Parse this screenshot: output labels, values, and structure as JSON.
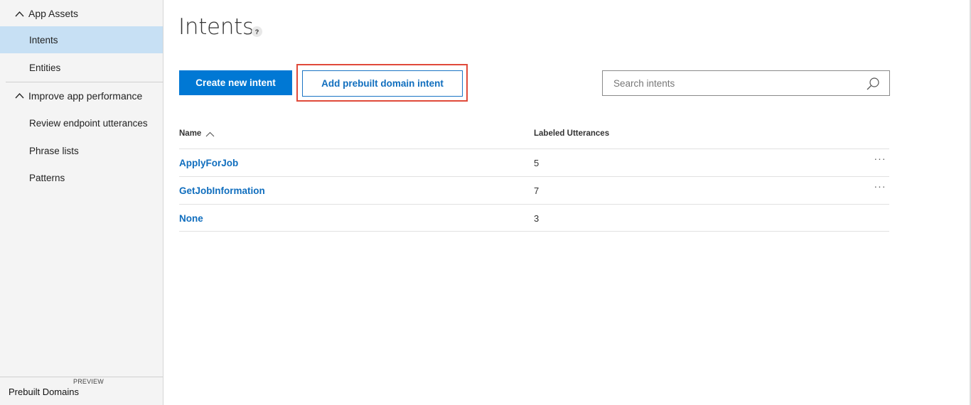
{
  "sidebar": {
    "sections": [
      {
        "label": "App Assets",
        "icon": "chevron-up-icon"
      },
      {
        "label": "Improve app performance",
        "icon": "chevron-up-icon"
      }
    ],
    "items": [
      {
        "label": "Intents",
        "active": true
      },
      {
        "label": "Entities"
      },
      {
        "label": "Review endpoint utterances"
      },
      {
        "label": "Phrase lists"
      },
      {
        "label": "Patterns"
      }
    ],
    "footer": {
      "preview_tag": "PREVIEW",
      "label": "Prebuilt Domains"
    }
  },
  "main": {
    "title": "Intents",
    "help_icon": "?",
    "create_button": "Create new intent",
    "add_prebuilt_button": "Add prebuilt domain intent",
    "search": {
      "placeholder": "Search intents",
      "value": "",
      "icon": "search-icon"
    },
    "table": {
      "columns": [
        "Name",
        "Labeled Utterances"
      ],
      "sort_icon": "chevron-up-icon",
      "rows": [
        {
          "name": "ApplyForJob",
          "count": "5",
          "more": "···"
        },
        {
          "name": "GetJobInformation",
          "count": "7",
          "more": "···"
        },
        {
          "name": "None",
          "count": "3"
        }
      ]
    }
  },
  "colors": {
    "accent": "#0078d4",
    "link": "#106ebe",
    "active_nav": "#c7e0f4",
    "highlight_outline": "#e04a3a",
    "sidebar_bg": "#f4f4f4"
  }
}
